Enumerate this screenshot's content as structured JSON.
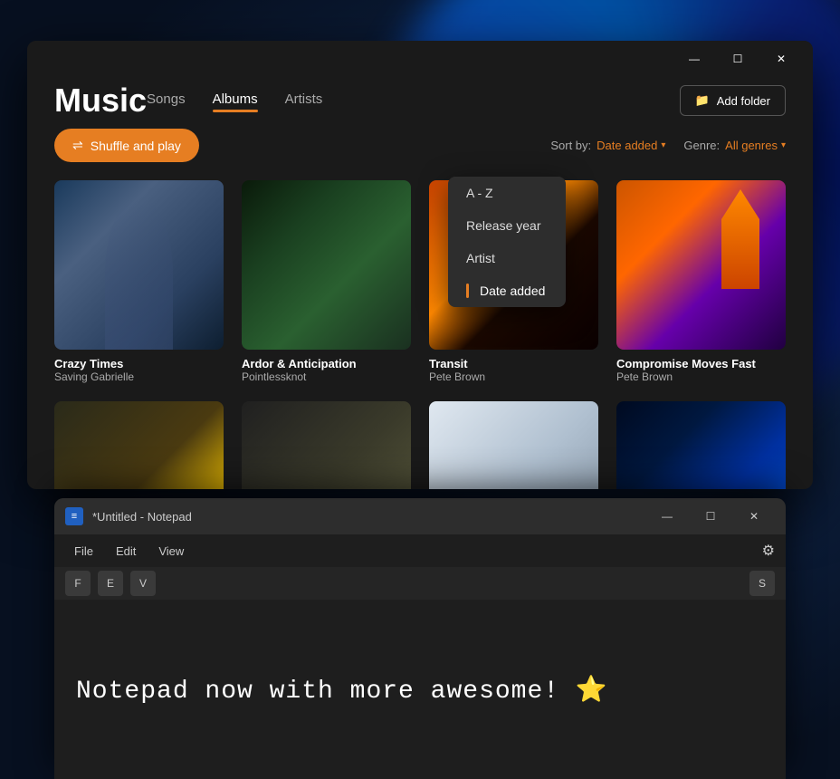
{
  "wallpaper": {
    "bg_color": "#0a1628"
  },
  "music_window": {
    "title": "Music",
    "titlebar": {
      "minimize_label": "—",
      "maximize_label": "☐",
      "close_label": "✕"
    },
    "nav": {
      "items": [
        {
          "label": "Songs",
          "active": false
        },
        {
          "label": "Albums",
          "active": true
        },
        {
          "label": "Artists",
          "active": false
        }
      ]
    },
    "add_folder_label": "Add folder",
    "toolbar": {
      "shuffle_label": "Shuffle and play",
      "sort_by_label": "Sort by:",
      "sort_value": "Date added",
      "genre_label": "Genre:",
      "genre_value": "All genres"
    },
    "dropdown": {
      "items": [
        {
          "label": "A - Z",
          "selected": false
        },
        {
          "label": "Release year",
          "selected": false
        },
        {
          "label": "Artist",
          "selected": false
        },
        {
          "label": "Date added",
          "selected": true
        }
      ]
    },
    "albums": [
      {
        "name": "Crazy Times",
        "artist": "Saving Gabrielle",
        "art_class": "art-crazy-times"
      },
      {
        "name": "Ardor & Anticipation",
        "artist": "Pointlessknot",
        "art_class": "art-ardor"
      },
      {
        "name": "Transit",
        "artist": "Pete Brown",
        "art_class": "art-transit"
      },
      {
        "name": "Compromise Moves Fast",
        "artist": "Pete Brown",
        "art_class": "art-compromise"
      },
      {
        "name": "",
        "artist": "",
        "art_class": "art-row2-1"
      },
      {
        "name": "",
        "artist": "",
        "art_class": "art-row2-2"
      },
      {
        "name": "",
        "artist": "",
        "art_class": "art-row2-3"
      },
      {
        "name": "",
        "artist": "",
        "art_class": "art-row2-4"
      }
    ]
  },
  "notepad_window": {
    "icon_label": "≡",
    "title": "*Untitled - Notepad",
    "titlebar": {
      "minimize_label": "—",
      "maximize_label": "☐",
      "close_label": "✕"
    },
    "menu": {
      "items": [
        {
          "label": "File"
        },
        {
          "label": "Edit"
        },
        {
          "label": "View"
        }
      ]
    },
    "shortcuts": {
      "keys": [
        "F",
        "E",
        "V"
      ],
      "right_key": "S"
    },
    "settings_icon": "⚙",
    "content": {
      "text": "Notepad now with more awesome!",
      "emoji": "⭐"
    }
  }
}
